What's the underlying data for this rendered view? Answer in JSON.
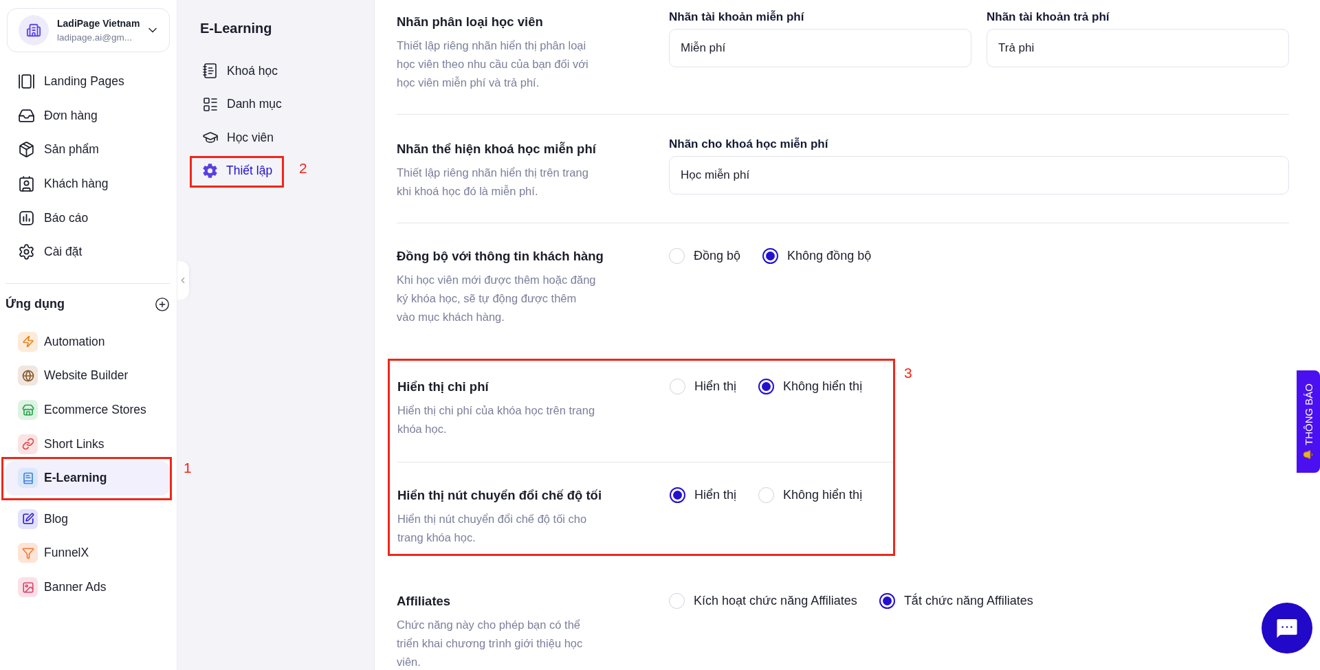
{
  "account": {
    "name": "LadiPage Vietnam",
    "email": "ladipage.ai@gm..."
  },
  "nav": [
    {
      "label": "Landing Pages",
      "selected": false
    },
    {
      "label": "Đơn hàng",
      "selected": false
    },
    {
      "label": "Sản phẩm",
      "selected": false
    },
    {
      "label": "Khách hàng",
      "selected": false
    },
    {
      "label": "Báo cáo",
      "selected": false
    },
    {
      "label": "Cài đặt",
      "selected": false
    }
  ],
  "apps_header": {
    "title": "Ứng dụng"
  },
  "apps": [
    {
      "label": "Automation",
      "selected": false
    },
    {
      "label": "Website Builder",
      "selected": false
    },
    {
      "label": "Ecommerce Stores",
      "selected": false
    },
    {
      "label": "Short Links",
      "selected": false
    },
    {
      "label": "E-Learning",
      "selected": true,
      "annotation": "1"
    },
    {
      "label": "Blog",
      "selected": false
    },
    {
      "label": "FunnelX",
      "selected": false
    },
    {
      "label": "Banner Ads",
      "selected": false
    }
  ],
  "subnav": {
    "title": "E-Learning",
    "items": [
      {
        "label": "Khoá học",
        "selected": false
      },
      {
        "label": "Danh mục",
        "selected": false
      },
      {
        "label": "Học viên",
        "selected": false
      },
      {
        "label": "Thiết lập",
        "selected": true,
        "annotation": "2"
      }
    ]
  },
  "sections": [
    {
      "kind": "fields",
      "title": "Nhãn phân loại học viên",
      "description": "Thiết lập riêng nhãn hiển thị phân loại học viên theo nhu cầu của bạn đối với học viên miễn phí và trả phí.",
      "fields": [
        {
          "label": "Nhãn tài khoản miễn phí",
          "value": "Miễn phí"
        },
        {
          "label": "Nhãn tài khoản trả phí",
          "value": "Trả phi"
        }
      ]
    },
    {
      "kind": "fields",
      "title": "Nhãn thể hiện khoá học miễn phí",
      "description": "Thiết lập riêng nhãn hiển thị trên trang khi khoá học đó là miễn phí.",
      "fields": [
        {
          "label": "Nhãn cho khoá học miễn phí",
          "value": "Học miễn phí"
        }
      ]
    },
    {
      "kind": "radio",
      "title": "Đồng bộ với thông tin khách hàng",
      "description": "Khi học viên mới được thêm hoặc đăng ký khóa học, sẽ tự động được thêm vào mục khách hàng.",
      "options": [
        {
          "label": "Đồng bộ",
          "selected": false
        },
        {
          "label": "Không đồng bộ",
          "selected": true
        }
      ]
    },
    {
      "kind": "group",
      "annotation": "3",
      "sections": [
        {
          "kind": "radio",
          "title": "Hiển thị chi phí",
          "description": "Hiển thị chi phí của khóa học trên trang khóa học.",
          "options": [
            {
              "label": "Hiển thị",
              "selected": false
            },
            {
              "label": "Không hiển thị",
              "selected": true
            }
          ]
        },
        {
          "kind": "radio",
          "title": "Hiển thị nút chuyển đổi chế độ tối",
          "description": "Hiển thị nút chuyển đổi chế độ tối cho trang khóa học.",
          "options": [
            {
              "label": "Hiển thị",
              "selected": true
            },
            {
              "label": "Không hiển thị",
              "selected": false
            }
          ]
        }
      ]
    },
    {
      "kind": "radio",
      "title": "Affiliates",
      "description": "Chức năng này cho phép bạn có thể triển khai chương trình giới thiệu học viên.",
      "options": [
        {
          "label": "Kích hoạt chức năng Affiliates",
          "selected": false
        },
        {
          "label": "Tắt chức năng Affiliates",
          "selected": true
        }
      ]
    }
  ],
  "notification_tab": {
    "label": "THÔNG BÁO"
  }
}
